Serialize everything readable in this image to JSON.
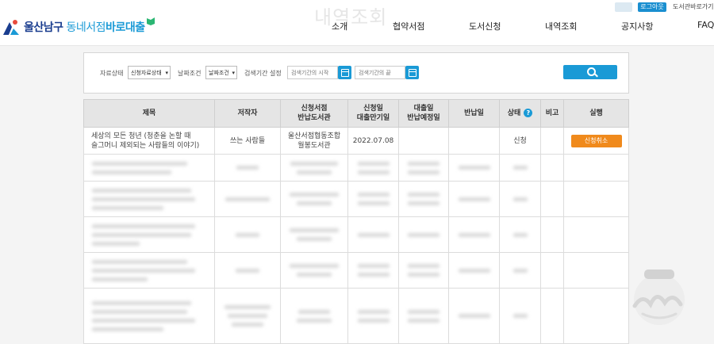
{
  "header": {
    "logo_city": "울산남구",
    "logo_service_prefix": "동네서점",
    "logo_service_suffix": "바로대출",
    "page_title_watermark": "내역조회",
    "util": {
      "login": "로그아웃",
      "library_link": "도서관바로가기"
    },
    "nav": [
      "소개",
      "협약서점",
      "도서신청",
      "내역조회",
      "공지사항",
      "FAQ"
    ]
  },
  "filters": {
    "status_label": "자료상태",
    "status_value": "신청자료상태",
    "date_label": "날짜조건",
    "date_value": "날짜조건",
    "period_label": "검색기간 설정",
    "start_placeholder": "검색기간의 시작",
    "end_placeholder": "검색기간의 끝"
  },
  "table": {
    "columns": [
      {
        "label": "제목"
      },
      {
        "label": "저작자"
      },
      {
        "line1": "신청서점",
        "line2": "반납도서관"
      },
      {
        "line1": "신청일",
        "line2": "대출만기일"
      },
      {
        "line1": "대출일",
        "line2": "반납예정일"
      },
      {
        "label": "반납일"
      },
      {
        "label": "상태",
        "help": "?"
      },
      {
        "label": "비고"
      },
      {
        "label": "실행"
      }
    ],
    "rows": [
      {
        "title_line1": "세상의 모든 청년 (청춘을 논할 때",
        "title_line2": "슬그머니 제외되는 사람들의 이야기)",
        "author": "쓰는 사람들",
        "store_line1": "울산서점협동조합",
        "store_line2": "월봉도서관",
        "request_date": "2022.07.08",
        "loan_date": "",
        "return_date": "",
        "status": "신청",
        "note": "",
        "action": "신청취소"
      }
    ]
  },
  "colors": {
    "accent": "#1a9ad6",
    "cancel_button": "#f08a1c",
    "header_bg": "#e5e5e5"
  },
  "icons": {
    "search": "search-icon",
    "calendar": "calendar-icon",
    "help": "help-icon",
    "dropdown": "chevron-down-icon"
  }
}
